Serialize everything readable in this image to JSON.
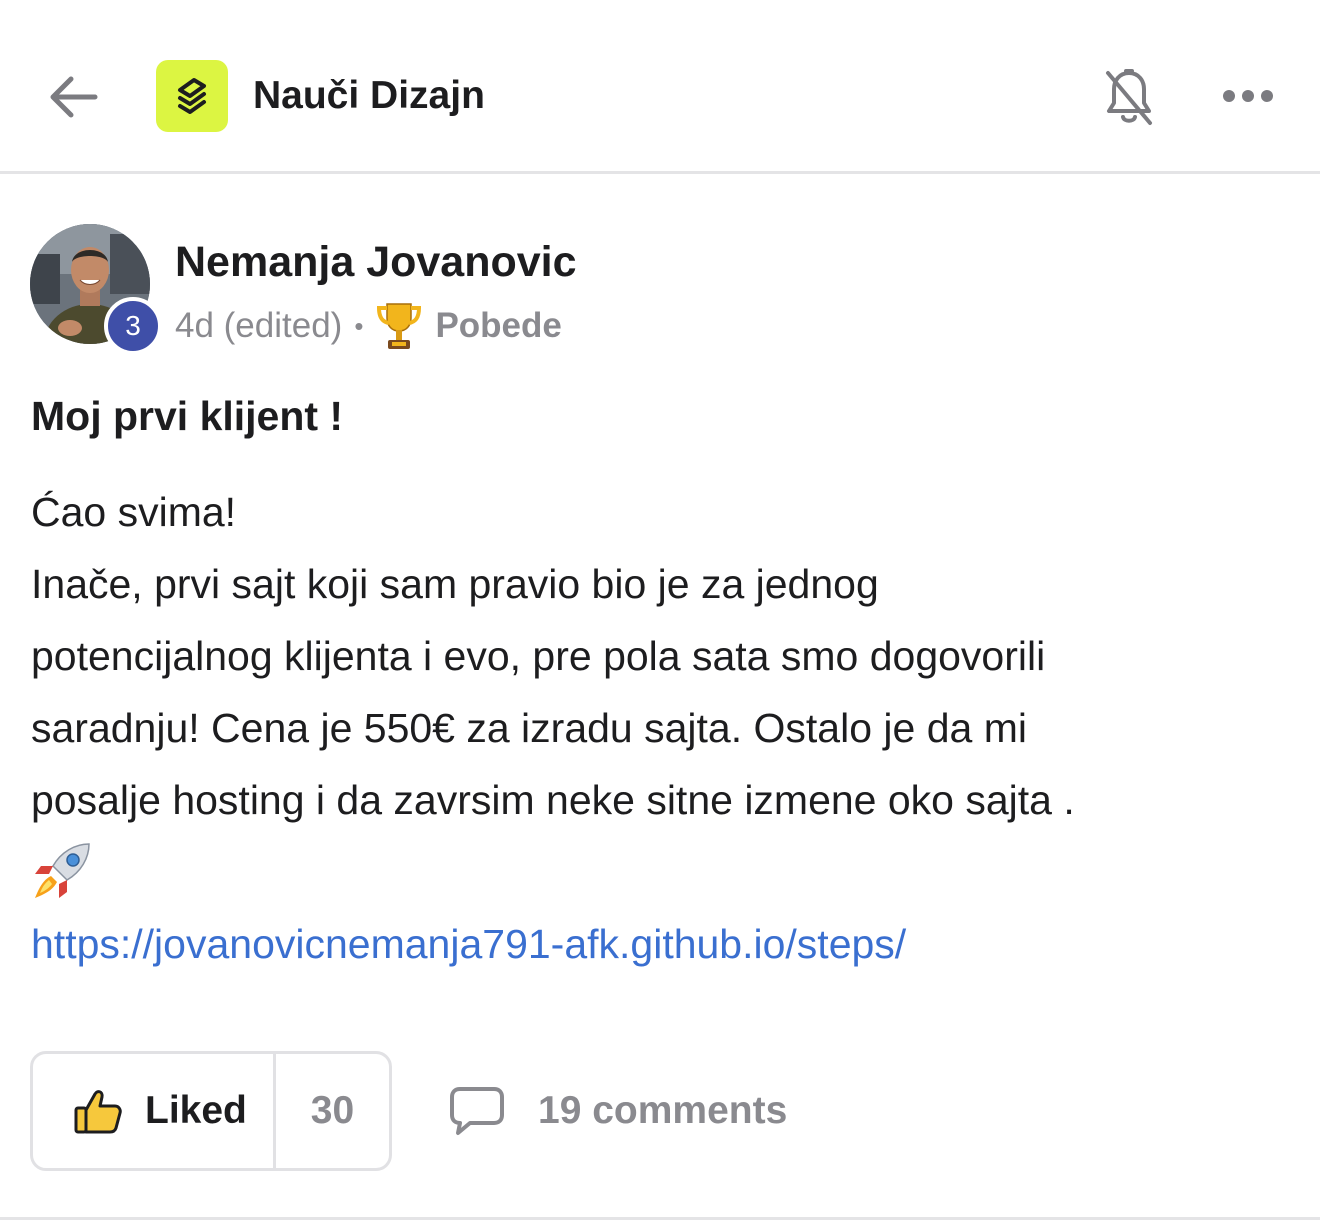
{
  "header": {
    "group_name": "Nauči Dizajn",
    "back_icon": "arrow-left-icon",
    "logo_icon": "layers-logo-icon",
    "bell_icon": "bell-off-icon",
    "more_icon": "more-horizontal-icon",
    "logo_color": "#dcf542"
  },
  "post": {
    "author": {
      "name": "Nemanja Jovanovic",
      "level": "3",
      "level_color": "#3f4fa8"
    },
    "meta": {
      "time": "4d (edited)",
      "separator": "•",
      "category": "Pobede",
      "category_icon": "trophy-icon"
    },
    "title": "Moj prvi klijent !",
    "body": {
      "line1": "Ćao svima!",
      "line2": "Inače, prvi sajt koji sam pravio bio je za jednog",
      "line3": "potencijalnog klijenta i evo, pre pola sata smo dogovorili",
      "line4": "saradnju! Cena je 550€ za izradu sajta. Ostalo je da mi",
      "line5": "posalje hosting i da zavrsim neke sitne izmene oko sajta .",
      "emoji_icon": "rocket-icon",
      "link": "https://jovanovicnemanja791-afk.github.io/steps/"
    },
    "actions": {
      "like_label": "Liked",
      "like_count": "30",
      "like_icon": "thumbs-up-icon",
      "comments_label": "19 comments",
      "comments_icon": "comment-bubble-icon"
    }
  },
  "colors": {
    "link": "#3a6fd0",
    "muted_text": "#8a8a8f",
    "divider": "#e4e4e6"
  }
}
